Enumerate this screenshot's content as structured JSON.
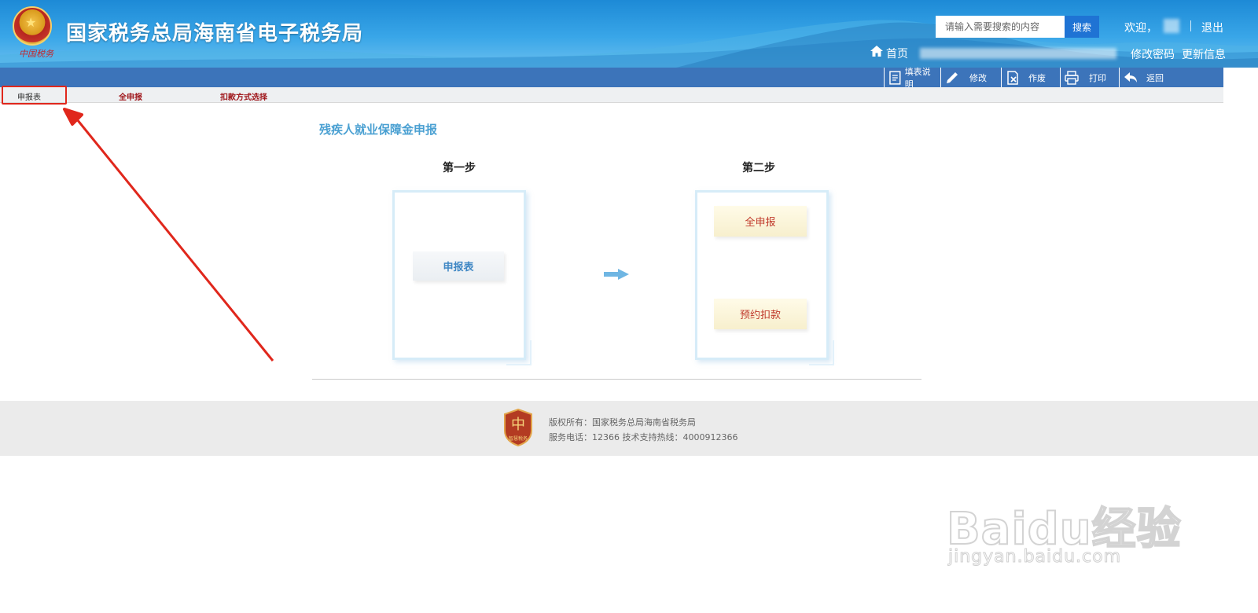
{
  "header": {
    "site_title": "国家税务总局海南省电子税务局",
    "logo_script": "中国税务",
    "search": {
      "placeholder": "请输入需要搜索的内容",
      "button_label": "搜索"
    },
    "welcome_label": "欢迎，",
    "logout_label": "退出",
    "home_label": "首页",
    "change_password_label": "修改密码",
    "update_info_label": "更新信息"
  },
  "toolbar": {
    "items": [
      {
        "label": "填表说明",
        "icon": "document-icon"
      },
      {
        "label": "修改",
        "icon": "pencil-icon"
      },
      {
        "label": "作废",
        "icon": "void-doc-icon"
      },
      {
        "label": "打印",
        "icon": "printer-icon"
      },
      {
        "label": "返回",
        "icon": "back-arrow-icon"
      }
    ]
  },
  "subnav": {
    "items": [
      {
        "label": "申报表",
        "active": true
      },
      {
        "label": "全申报",
        "active": false
      },
      {
        "label": "扣款方式选择",
        "active": false
      }
    ]
  },
  "main": {
    "title": "残疾人就业保障金申报",
    "step1": {
      "title": "第一步",
      "button": "申报表"
    },
    "step2": {
      "title": "第二步",
      "buttons": [
        "全申报",
        "预约扣款"
      ]
    }
  },
  "footer": {
    "badge_label": "智慧税务",
    "copyright": "版权所有：国家税务总局海南省税务局",
    "phone": "服务电话：12366 技术支持热线：4000912366"
  },
  "watermark": {
    "brand": "Baidu经验",
    "url": "jingyan.baidu.com"
  },
  "colors": {
    "header_blue": "#1d8ad6",
    "toolbar_blue": "#3c74ba",
    "title_blue": "#4aa0d2",
    "subnav_link_red": "#a0191e",
    "annotation_red": "#e0271c"
  }
}
